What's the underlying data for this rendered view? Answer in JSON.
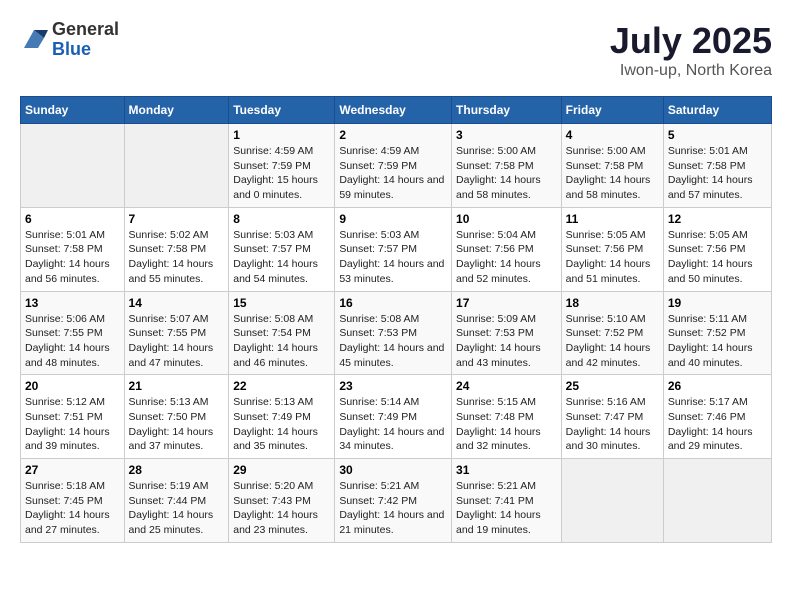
{
  "app": {
    "logo_line1": "General",
    "logo_line2": "Blue"
  },
  "header": {
    "title": "July 2025",
    "subtitle": "Iwon-up, North Korea"
  },
  "days_of_week": [
    "Sunday",
    "Monday",
    "Tuesday",
    "Wednesday",
    "Thursday",
    "Friday",
    "Saturday"
  ],
  "weeks": [
    [
      {
        "day": "",
        "sunrise": "",
        "sunset": "",
        "daylight": ""
      },
      {
        "day": "",
        "sunrise": "",
        "sunset": "",
        "daylight": ""
      },
      {
        "day": "1",
        "sunrise": "Sunrise: 4:59 AM",
        "sunset": "Sunset: 7:59 PM",
        "daylight": "Daylight: 15 hours and 0 minutes."
      },
      {
        "day": "2",
        "sunrise": "Sunrise: 4:59 AM",
        "sunset": "Sunset: 7:59 PM",
        "daylight": "Daylight: 14 hours and 59 minutes."
      },
      {
        "day": "3",
        "sunrise": "Sunrise: 5:00 AM",
        "sunset": "Sunset: 7:58 PM",
        "daylight": "Daylight: 14 hours and 58 minutes."
      },
      {
        "day": "4",
        "sunrise": "Sunrise: 5:00 AM",
        "sunset": "Sunset: 7:58 PM",
        "daylight": "Daylight: 14 hours and 58 minutes."
      },
      {
        "day": "5",
        "sunrise": "Sunrise: 5:01 AM",
        "sunset": "Sunset: 7:58 PM",
        "daylight": "Daylight: 14 hours and 57 minutes."
      }
    ],
    [
      {
        "day": "6",
        "sunrise": "Sunrise: 5:01 AM",
        "sunset": "Sunset: 7:58 PM",
        "daylight": "Daylight: 14 hours and 56 minutes."
      },
      {
        "day": "7",
        "sunrise": "Sunrise: 5:02 AM",
        "sunset": "Sunset: 7:58 PM",
        "daylight": "Daylight: 14 hours and 55 minutes."
      },
      {
        "day": "8",
        "sunrise": "Sunrise: 5:03 AM",
        "sunset": "Sunset: 7:57 PM",
        "daylight": "Daylight: 14 hours and 54 minutes."
      },
      {
        "day": "9",
        "sunrise": "Sunrise: 5:03 AM",
        "sunset": "Sunset: 7:57 PM",
        "daylight": "Daylight: 14 hours and 53 minutes."
      },
      {
        "day": "10",
        "sunrise": "Sunrise: 5:04 AM",
        "sunset": "Sunset: 7:56 PM",
        "daylight": "Daylight: 14 hours and 52 minutes."
      },
      {
        "day": "11",
        "sunrise": "Sunrise: 5:05 AM",
        "sunset": "Sunset: 7:56 PM",
        "daylight": "Daylight: 14 hours and 51 minutes."
      },
      {
        "day": "12",
        "sunrise": "Sunrise: 5:05 AM",
        "sunset": "Sunset: 7:56 PM",
        "daylight": "Daylight: 14 hours and 50 minutes."
      }
    ],
    [
      {
        "day": "13",
        "sunrise": "Sunrise: 5:06 AM",
        "sunset": "Sunset: 7:55 PM",
        "daylight": "Daylight: 14 hours and 48 minutes."
      },
      {
        "day": "14",
        "sunrise": "Sunrise: 5:07 AM",
        "sunset": "Sunset: 7:55 PM",
        "daylight": "Daylight: 14 hours and 47 minutes."
      },
      {
        "day": "15",
        "sunrise": "Sunrise: 5:08 AM",
        "sunset": "Sunset: 7:54 PM",
        "daylight": "Daylight: 14 hours and 46 minutes."
      },
      {
        "day": "16",
        "sunrise": "Sunrise: 5:08 AM",
        "sunset": "Sunset: 7:53 PM",
        "daylight": "Daylight: 14 hours and 45 minutes."
      },
      {
        "day": "17",
        "sunrise": "Sunrise: 5:09 AM",
        "sunset": "Sunset: 7:53 PM",
        "daylight": "Daylight: 14 hours and 43 minutes."
      },
      {
        "day": "18",
        "sunrise": "Sunrise: 5:10 AM",
        "sunset": "Sunset: 7:52 PM",
        "daylight": "Daylight: 14 hours and 42 minutes."
      },
      {
        "day": "19",
        "sunrise": "Sunrise: 5:11 AM",
        "sunset": "Sunset: 7:52 PM",
        "daylight": "Daylight: 14 hours and 40 minutes."
      }
    ],
    [
      {
        "day": "20",
        "sunrise": "Sunrise: 5:12 AM",
        "sunset": "Sunset: 7:51 PM",
        "daylight": "Daylight: 14 hours and 39 minutes."
      },
      {
        "day": "21",
        "sunrise": "Sunrise: 5:13 AM",
        "sunset": "Sunset: 7:50 PM",
        "daylight": "Daylight: 14 hours and 37 minutes."
      },
      {
        "day": "22",
        "sunrise": "Sunrise: 5:13 AM",
        "sunset": "Sunset: 7:49 PM",
        "daylight": "Daylight: 14 hours and 35 minutes."
      },
      {
        "day": "23",
        "sunrise": "Sunrise: 5:14 AM",
        "sunset": "Sunset: 7:49 PM",
        "daylight": "Daylight: 14 hours and 34 minutes."
      },
      {
        "day": "24",
        "sunrise": "Sunrise: 5:15 AM",
        "sunset": "Sunset: 7:48 PM",
        "daylight": "Daylight: 14 hours and 32 minutes."
      },
      {
        "day": "25",
        "sunrise": "Sunrise: 5:16 AM",
        "sunset": "Sunset: 7:47 PM",
        "daylight": "Daylight: 14 hours and 30 minutes."
      },
      {
        "day": "26",
        "sunrise": "Sunrise: 5:17 AM",
        "sunset": "Sunset: 7:46 PM",
        "daylight": "Daylight: 14 hours and 29 minutes."
      }
    ],
    [
      {
        "day": "27",
        "sunrise": "Sunrise: 5:18 AM",
        "sunset": "Sunset: 7:45 PM",
        "daylight": "Daylight: 14 hours and 27 minutes."
      },
      {
        "day": "28",
        "sunrise": "Sunrise: 5:19 AM",
        "sunset": "Sunset: 7:44 PM",
        "daylight": "Daylight: 14 hours and 25 minutes."
      },
      {
        "day": "29",
        "sunrise": "Sunrise: 5:20 AM",
        "sunset": "Sunset: 7:43 PM",
        "daylight": "Daylight: 14 hours and 23 minutes."
      },
      {
        "day": "30",
        "sunrise": "Sunrise: 5:21 AM",
        "sunset": "Sunset: 7:42 PM",
        "daylight": "Daylight: 14 hours and 21 minutes."
      },
      {
        "day": "31",
        "sunrise": "Sunrise: 5:21 AM",
        "sunset": "Sunset: 7:41 PM",
        "daylight": "Daylight: 14 hours and 19 minutes."
      },
      {
        "day": "",
        "sunrise": "",
        "sunset": "",
        "daylight": ""
      },
      {
        "day": "",
        "sunrise": "",
        "sunset": "",
        "daylight": ""
      }
    ]
  ]
}
